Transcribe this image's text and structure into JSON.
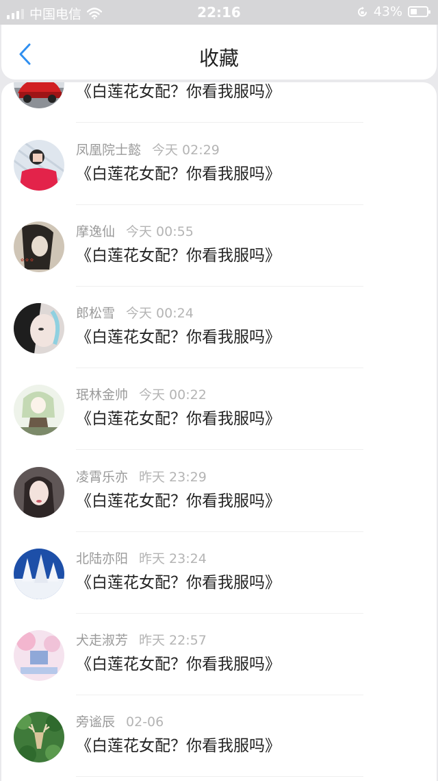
{
  "status_bar": {
    "carrier": "中国电信",
    "time": "22:16",
    "battery": "43%",
    "battery_level": 0.43
  },
  "nav": {
    "title": "收藏",
    "back_icon": "chevron-left-icon"
  },
  "colors": {
    "accent": "#2f8ff0",
    "name_text": "#9a9a9a",
    "time_text": "#b4b4b4",
    "title_text": "#222222"
  },
  "items": [
    {
      "name": "",
      "time": "",
      "book": "《白莲花女配？你看我服吗》",
      "avatar": "red-car-avatar"
    },
    {
      "name": "凤凰院士懿",
      "time": "今天 02:29",
      "book": "《白莲花女配？你看我服吗》",
      "avatar": "boy-red-shirt-avatar"
    },
    {
      "name": "摩逸仙",
      "time": "今天 00:55",
      "book": "《白莲花女配？你看我服吗》",
      "avatar": "girl-sepia-avatar"
    },
    {
      "name": "郎松雪",
      "time": "今天 00:24",
      "book": "《白莲花女配？你看我服吗》",
      "avatar": "girl-face-avatar"
    },
    {
      "name": "珉林金帅",
      "time": "今天 00:22",
      "book": "《白莲花女配？你看我服吗》",
      "avatar": "anime-girl-avatar"
    },
    {
      "name": "凌霄乐亦",
      "time": "昨天 23:29",
      "book": "《白莲花女配？你看我服吗》",
      "avatar": "girl-portrait-avatar"
    },
    {
      "name": "北陆亦阳",
      "time": "昨天 23:24",
      "book": "《白莲花女配？你看我服吗》",
      "avatar": "snow-trees-avatar"
    },
    {
      "name": "犬走淑芳",
      "time": "昨天 22:57",
      "book": "《白莲花女配？你看我服吗》",
      "avatar": "pink-scene-avatar"
    },
    {
      "name": "旁谧辰",
      "time": "02-06",
      "book": "《白莲花女配？你看我服吗》",
      "avatar": "deer-forest-avatar"
    }
  ]
}
